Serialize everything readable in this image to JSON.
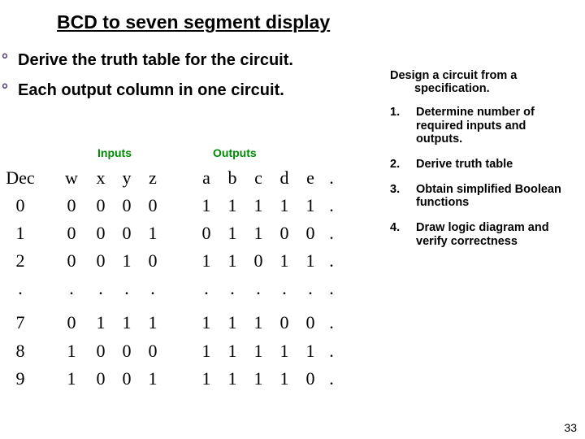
{
  "title": "BCD to seven segment display",
  "bullets": [
    "Derive the truth table for the circuit.",
    "Each output column in one circuit."
  ],
  "io_labels": {
    "inputs": "Inputs",
    "outputs": "Outputs"
  },
  "table": {
    "head": {
      "dec": "Dec",
      "w": "w",
      "x": "x",
      "y": "y",
      "z": "z",
      "a": "a",
      "b": "b",
      "c": "c",
      "d": "d",
      "e": "e",
      "dot": "."
    },
    "rows_top": [
      {
        "dec": "0",
        "w": "0",
        "x": "0",
        "y": "0",
        "z": "0",
        "a": "1",
        "b": "1",
        "c": "1",
        "d": "1",
        "e": "1",
        "dot": "."
      },
      {
        "dec": "1",
        "w": "0",
        "x": "0",
        "y": "0",
        "z": "1",
        "a": "0",
        "b": "1",
        "c": "1",
        "d": "0",
        "e": "0",
        "dot": "."
      },
      {
        "dec": "2",
        "w": "0",
        "x": "0",
        "y": "1",
        "z": "0",
        "a": "1",
        "b": "1",
        "c": "0",
        "d": "1",
        "e": "1",
        "dot": "."
      },
      {
        "dec": ".",
        "w": ".",
        "x": ".",
        "y": ".",
        "z": ".",
        "a": ".",
        "b": ".",
        "c": ".",
        "d": ".",
        "e": ".",
        "dot": "."
      }
    ],
    "rows_bot": [
      {
        "dec": "7",
        "w": "0",
        "x": "1",
        "y": "1",
        "z": "1",
        "a": "1",
        "b": "1",
        "c": "1",
        "d": "0",
        "e": "0",
        "dot": "."
      },
      {
        "dec": "8",
        "w": "1",
        "x": "0",
        "y": "0",
        "z": "0",
        "a": "1",
        "b": "1",
        "c": "1",
        "d": "1",
        "e": "1",
        "dot": "."
      },
      {
        "dec": "9",
        "w": "1",
        "x": "0",
        "y": "0",
        "z": "1",
        "a": "1",
        "b": "1",
        "c": "1",
        "d": "1",
        "e": "0",
        "dot": "."
      }
    ]
  },
  "design": {
    "title_l1": "Design a circuit from a",
    "title_l2": "specification.",
    "steps": [
      {
        "n": "1.",
        "t": "Determine number of required inputs and outputs."
      },
      {
        "n": "2.",
        "t": "Derive truth table"
      },
      {
        "n": "3.",
        "t": "Obtain simplified Boolean functions"
      },
      {
        "n": "4.",
        "t": "Draw logic diagram and verify correctness"
      }
    ]
  },
  "pagenum": "33",
  "chart_data": {
    "type": "table",
    "title": "BCD to seven-segment truth table (partial)",
    "columns": [
      "Dec",
      "w",
      "x",
      "y",
      "z",
      "a",
      "b",
      "c",
      "d",
      "e"
    ],
    "rows": [
      [
        0,
        0,
        0,
        0,
        0,
        1,
        1,
        1,
        1,
        1
      ],
      [
        1,
        0,
        0,
        0,
        1,
        0,
        1,
        1,
        0,
        0
      ],
      [
        2,
        0,
        0,
        1,
        0,
        1,
        1,
        0,
        1,
        1
      ],
      [
        7,
        0,
        1,
        1,
        1,
        1,
        1,
        1,
        0,
        0
      ],
      [
        8,
        1,
        0,
        0,
        0,
        1,
        1,
        1,
        1,
        1
      ],
      [
        9,
        1,
        0,
        0,
        1,
        1,
        1,
        1,
        1,
        0
      ]
    ]
  }
}
